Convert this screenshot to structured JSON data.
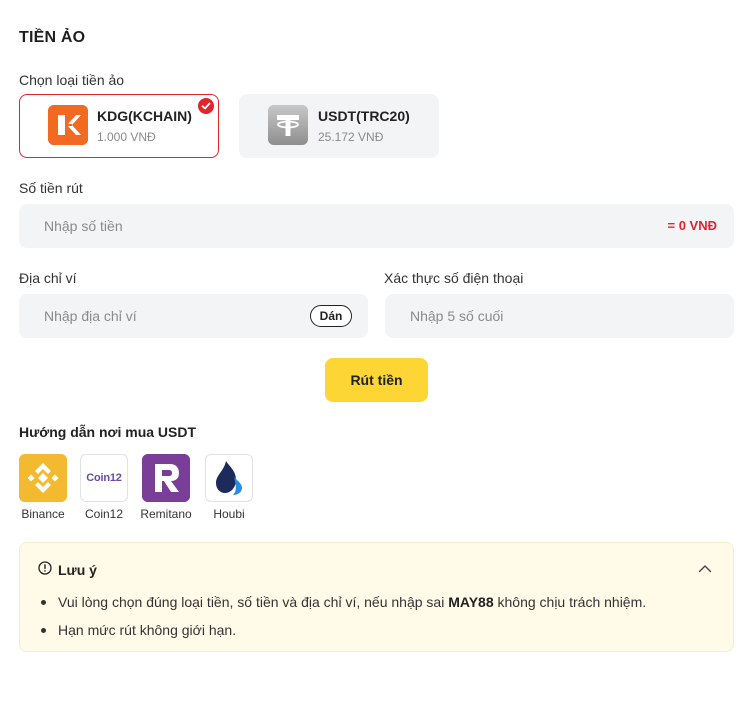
{
  "page": {
    "title": "TIỀN ẢO"
  },
  "coin_section": {
    "label": "Chọn loại tiền ảo",
    "coins": [
      {
        "name": "KDG(KCHAIN)",
        "rate": "1.000 VNĐ",
        "selected": true,
        "icon": "kchain-logo-icon",
        "color": "#f26a21"
      },
      {
        "name": "USDT(TRC20)",
        "rate": "25.172 VNĐ",
        "selected": false,
        "icon": "tether-logo-icon",
        "color": "#9b9b9b"
      }
    ]
  },
  "amount": {
    "label": "Số tiền rút",
    "placeholder": "Nhập số tiền",
    "converted": "= 0 VNĐ"
  },
  "wallet": {
    "label": "Địa chỉ ví",
    "placeholder": "Nhập địa chỉ ví",
    "paste_label": "Dán"
  },
  "phone": {
    "label": "Xác thực số điện thoại",
    "placeholder": "Nhập 5 số cuối"
  },
  "submit": {
    "label": "Rút tiền",
    "color": "#fdd534"
  },
  "guide": {
    "title": "Hướng dẫn nơi mua USDT",
    "exchanges": [
      {
        "name": "Binance",
        "icon": "binance-logo-icon",
        "color": "#f3ba2f"
      },
      {
        "name": "Coin12",
        "icon": "coin12-logo-icon",
        "logo_text": "Coin12"
      },
      {
        "name": "Remitano",
        "icon": "remitano-logo-icon",
        "color": "#7b3e98"
      },
      {
        "name": "Houbi",
        "icon": "huobi-logo-icon",
        "color": "#1c2b5a"
      }
    ]
  },
  "note": {
    "title": "Lưu ý",
    "items": [
      {
        "before": "Vui lòng chọn đúng loại tiền, số tiền và địa chỉ ví, nếu nhập sai ",
        "bold": "MAY88",
        "after": " không chịu trách nhiệm."
      },
      {
        "before": "Hạn mức rút không giới hạn.",
        "bold": "",
        "after": ""
      }
    ]
  },
  "colors": {
    "accent": "#e0252b",
    "field_bg": "#f3f4f6",
    "note_bg": "#fffbe8"
  }
}
